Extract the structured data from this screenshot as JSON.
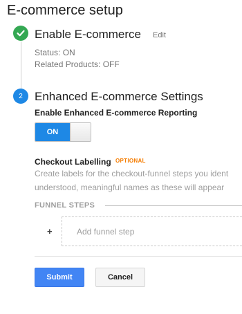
{
  "page": {
    "title": "E-commerce setup"
  },
  "step1": {
    "title": "Enable E-commerce",
    "edit_label": "Edit",
    "status": "Status: ON",
    "related_products": "Related Products: OFF",
    "icon": "check-icon",
    "color": "#34a853"
  },
  "step2": {
    "number": "2",
    "title": "Enhanced E-commerce Settings",
    "reporting_label": "Enable Enhanced E-commerce Reporting",
    "toggle": {
      "label": "ON",
      "state": true,
      "color": "#1e88e5"
    }
  },
  "checkout": {
    "title": "Checkout Labelling",
    "badge": "OPTIONAL",
    "description_line1": "Create labels for the checkout-funnel steps you ident",
    "description_line2": "understood, meaningful names as these will appear"
  },
  "funnel": {
    "label": "FUNNEL STEPS",
    "plus": "+",
    "add_placeholder": "Add funnel step"
  },
  "actions": {
    "submit_label": "Submit",
    "cancel_label": "Cancel",
    "accent": "#4285f4"
  }
}
